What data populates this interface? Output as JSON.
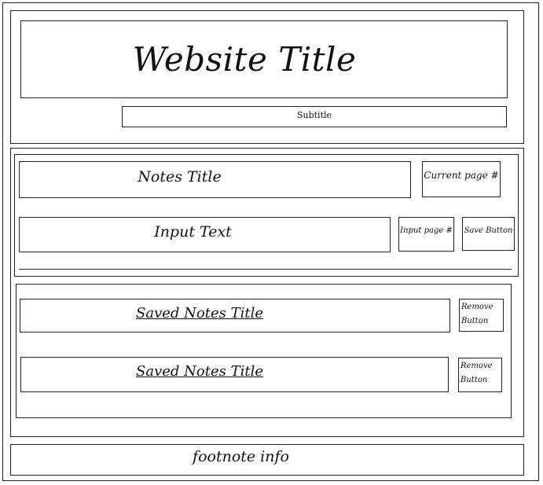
{
  "header": {
    "title": "Website Title",
    "subtitle": "Subtitle"
  },
  "notes_editor": {
    "notes_title": "Notes Title",
    "current_page": "Current page #",
    "input_text": "Input Text",
    "input_page": "Input page #",
    "save_button": "Save Button"
  },
  "saved_notes": [
    {
      "title": "Saved Notes Title",
      "remove_label": "Remove\nButton"
    },
    {
      "title": "Saved Notes Title",
      "remove_label": "Remove\nButton"
    }
  ],
  "footer": {
    "footnote": "footnote info"
  }
}
